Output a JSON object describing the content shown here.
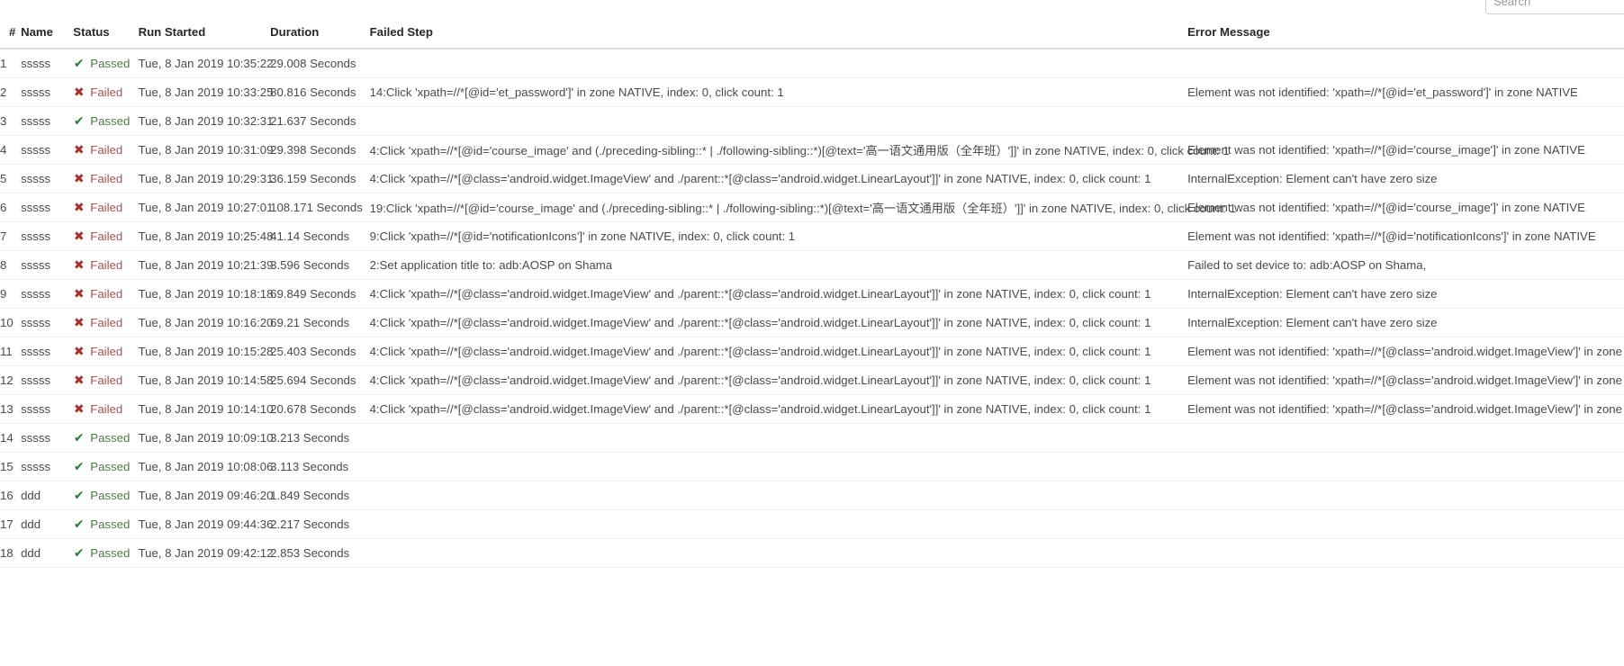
{
  "search": {
    "placeholder": "Search",
    "value": ""
  },
  "table": {
    "columns": [
      {
        "key": "num",
        "label": "#"
      },
      {
        "key": "name",
        "label": "Name"
      },
      {
        "key": "status",
        "label": "Status"
      },
      {
        "key": "started",
        "label": "Run Started"
      },
      {
        "key": "duration",
        "label": "Duration"
      },
      {
        "key": "step",
        "label": "Failed Step"
      },
      {
        "key": "error",
        "label": "Error Message"
      }
    ],
    "status_icons": {
      "passed": "check-icon",
      "failed": "cross-icon"
    },
    "status_glyphs": {
      "passed": "✔",
      "failed": "✖"
    },
    "colors": {
      "passed_icon": "#2e7d32",
      "passed_text": "#4f7a46",
      "failed_icon": "#a83232",
      "failed_text": "#a1564f",
      "header_text": "#26282b",
      "body_text": "#4a4a4a",
      "row_border": "#ececec",
      "header_border": "#dfdfdf"
    },
    "rows": [
      {
        "num": "1",
        "name": "sssss",
        "status": "Passed",
        "status_key": "passed",
        "started": "Tue, 8 Jan 2019 10:35:22",
        "duration": "29.008 Seconds",
        "step": "",
        "error": ""
      },
      {
        "num": "2",
        "name": "sssss",
        "status": "Failed",
        "status_key": "failed",
        "started": "Tue, 8 Jan 2019 10:33:25",
        "duration": "80.816 Seconds",
        "step": "14:Click 'xpath=//*[@id='et_password']' in zone NATIVE, index: 0, click count: 1",
        "error": "Element was not identified: 'xpath=//*[@id='et_password']' in zone NATIVE"
      },
      {
        "num": "3",
        "name": "sssss",
        "status": "Passed",
        "status_key": "passed",
        "started": "Tue, 8 Jan 2019 10:32:31",
        "duration": "21.637 Seconds",
        "step": "",
        "error": ""
      },
      {
        "num": "4",
        "name": "sssss",
        "status": "Failed",
        "status_key": "failed",
        "started": "Tue, 8 Jan 2019 10:31:09",
        "duration": "29.398 Seconds",
        "step": "4:Click 'xpath=//*[@id='course_image' and (./preceding-sibling::* | ./following-sibling::*)[@text='高一语文通用版（全年班）']]' in zone NATIVE, index: 0, click count: 1",
        "error": "Element was not identified: 'xpath=//*[@id='course_image']' in zone NATIVE"
      },
      {
        "num": "5",
        "name": "sssss",
        "status": "Failed",
        "status_key": "failed",
        "started": "Tue, 8 Jan 2019 10:29:31",
        "duration": "36.159 Seconds",
        "step": "4:Click 'xpath=//*[@class='android.widget.ImageView' and ./parent::*[@class='android.widget.LinearLayout']]' in zone NATIVE, index: 0, click count: 1",
        "error": "InternalException: Element can't have zero size"
      },
      {
        "num": "6",
        "name": "sssss",
        "status": "Failed",
        "status_key": "failed",
        "started": "Tue, 8 Jan 2019 10:27:01",
        "duration": "108.171 Seconds",
        "step": "19:Click 'xpath=//*[@id='course_image' and (./preceding-sibling::* | ./following-sibling::*)[@text='高一语文通用版（全年班）']]' in zone NATIVE, index: 0, click count: 1",
        "error": "Element was not identified: 'xpath=//*[@id='course_image']' in zone NATIVE"
      },
      {
        "num": "7",
        "name": "sssss",
        "status": "Failed",
        "status_key": "failed",
        "started": "Tue, 8 Jan 2019 10:25:48",
        "duration": "41.14 Seconds",
        "step": "9:Click 'xpath=//*[@id='notificationIcons']' in zone NATIVE, index: 0, click count: 1",
        "error": "Element was not identified: 'xpath=//*[@id='notificationIcons']' in zone NATIVE"
      },
      {
        "num": "8",
        "name": "sssss",
        "status": "Failed",
        "status_key": "failed",
        "started": "Tue, 8 Jan 2019 10:21:39",
        "duration": "3.596 Seconds",
        "step": "2:Set application title to: adb:AOSP on Shama",
        "error": "Failed to set device to: adb:AOSP on Shama, "
      },
      {
        "num": "9",
        "name": "sssss",
        "status": "Failed",
        "status_key": "failed",
        "started": "Tue, 8 Jan 2019 10:18:18",
        "duration": "69.849 Seconds",
        "step": "4:Click 'xpath=//*[@class='android.widget.ImageView' and ./parent::*[@class='android.widget.LinearLayout']]' in zone NATIVE, index: 0, click count: 1",
        "error": "InternalException: Element can't have zero size"
      },
      {
        "num": "10",
        "name": "sssss",
        "status": "Failed",
        "status_key": "failed",
        "started": "Tue, 8 Jan 2019 10:16:20",
        "duration": "69.21 Seconds",
        "step": "4:Click 'xpath=//*[@class='android.widget.ImageView' and ./parent::*[@class='android.widget.LinearLayout']]' in zone NATIVE, index: 0, click count: 1",
        "error": "InternalException: Element can't have zero size"
      },
      {
        "num": "11",
        "name": "sssss",
        "status": "Failed",
        "status_key": "failed",
        "started": "Tue, 8 Jan 2019 10:15:28",
        "duration": "25.403 Seconds",
        "step": "4:Click 'xpath=//*[@class='android.widget.ImageView' and ./parent::*[@class='android.widget.LinearLayout']]' in zone NATIVE, index: 0, click count: 1",
        "error": "Element was not identified: 'xpath=//*[@class='android.widget.ImageView']' in zone NATIVE"
      },
      {
        "num": "12",
        "name": "sssss",
        "status": "Failed",
        "status_key": "failed",
        "started": "Tue, 8 Jan 2019 10:14:58",
        "duration": "25.694 Seconds",
        "step": "4:Click 'xpath=//*[@class='android.widget.ImageView' and ./parent::*[@class='android.widget.LinearLayout']]' in zone NATIVE, index: 0, click count: 1",
        "error": "Element was not identified: 'xpath=//*[@class='android.widget.ImageView']' in zone NATIVE"
      },
      {
        "num": "13",
        "name": "sssss",
        "status": "Failed",
        "status_key": "failed",
        "started": "Tue, 8 Jan 2019 10:14:10",
        "duration": "20.678 Seconds",
        "step": "4:Click 'xpath=//*[@class='android.widget.ImageView' and ./parent::*[@class='android.widget.LinearLayout']]' in zone NATIVE, index: 0, click count: 1",
        "error": "Element was not identified: 'xpath=//*[@class='android.widget.ImageView']' in zone NATIVE"
      },
      {
        "num": "14",
        "name": "sssss",
        "status": "Passed",
        "status_key": "passed",
        "started": "Tue, 8 Jan 2019 10:09:10",
        "duration": "3.213 Seconds",
        "step": "",
        "error": ""
      },
      {
        "num": "15",
        "name": "sssss",
        "status": "Passed",
        "status_key": "passed",
        "started": "Tue, 8 Jan 2019 10:08:06",
        "duration": "3.113 Seconds",
        "step": "",
        "error": ""
      },
      {
        "num": "16",
        "name": "ddd",
        "status": "Passed",
        "status_key": "passed",
        "started": "Tue, 8 Jan 2019 09:46:20",
        "duration": "1.849 Seconds",
        "step": "",
        "error": ""
      },
      {
        "num": "17",
        "name": "ddd",
        "status": "Passed",
        "status_key": "passed",
        "started": "Tue, 8 Jan 2019 09:44:36",
        "duration": "2.217 Seconds",
        "step": "",
        "error": ""
      },
      {
        "num": "18",
        "name": "ddd",
        "status": "Passed",
        "status_key": "passed",
        "started": "Tue, 8 Jan 2019 09:42:12",
        "duration": "2.853 Seconds",
        "step": "",
        "error": ""
      }
    ]
  }
}
